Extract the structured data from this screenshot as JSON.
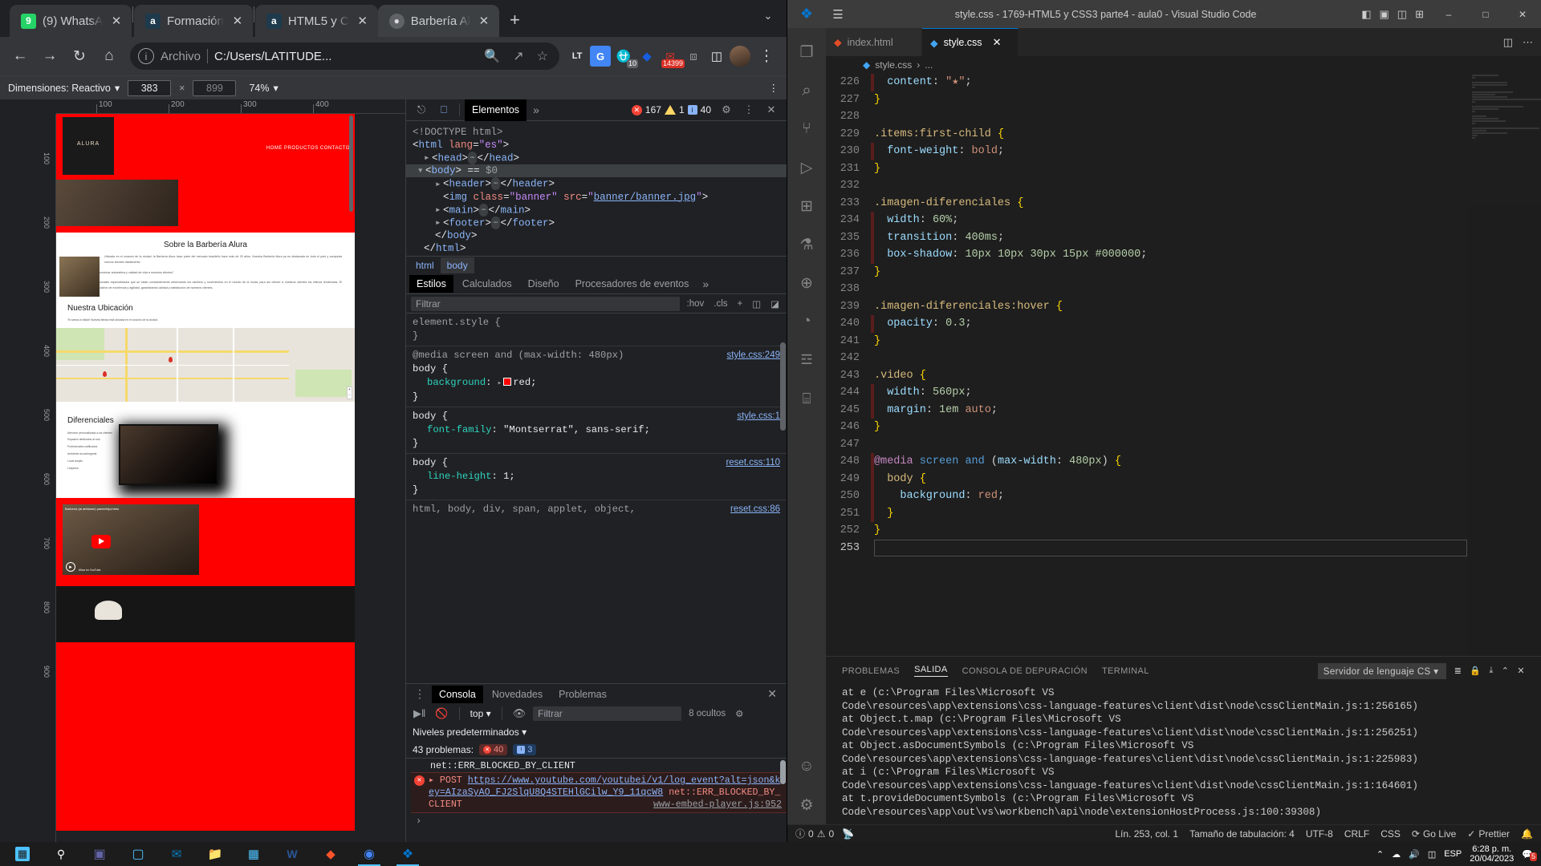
{
  "browser": {
    "tabs": [
      {
        "title": "(9) WhatsA",
        "favicon_name": "whatsapp-icon",
        "favicon_char": "9",
        "favicon_bg": "#25d366",
        "active": false
      },
      {
        "title": "Formación",
        "favicon_name": "alura-icon",
        "favicon_char": "a",
        "favicon_bg": "#1e3a4c",
        "active": false
      },
      {
        "title": "HTML5 y C",
        "favicon_name": "alura-icon",
        "favicon_char": "a",
        "favicon_bg": "#1e3a4c",
        "active": false
      },
      {
        "title": "Barbería Al",
        "favicon_name": "globe-icon",
        "favicon_char": "●",
        "favicon_bg": "#5f6368",
        "active": true
      }
    ],
    "new_tab_label": "+",
    "window_controls": {
      "minimize": "–",
      "maximize": "□",
      "close": "✕",
      "collapse": "⌄"
    },
    "toolbar": {
      "back": "←",
      "forward": "→",
      "reload": "↻",
      "home": "⌂",
      "scheme_label": "Archivo",
      "url": "C:/Users/LATITUDE...",
      "zoom_action": "search-zoom",
      "share_action": "share",
      "bookmark_action": "star"
    },
    "extensions": [
      {
        "name": "languagetool-icon",
        "glyph": "LT",
        "badge": ""
      },
      {
        "name": "google-translate-icon",
        "glyph": "G",
        "badge": ""
      },
      {
        "name": "adblock-icon",
        "glyph": "⛨",
        "badge": "10"
      },
      {
        "name": "bitwarden-icon",
        "glyph": "◈",
        "badge": ""
      },
      {
        "name": "mail-icon",
        "glyph": "✉",
        "badge": "14399"
      },
      {
        "name": "puzzle-extensions-icon",
        "glyph": "⧉",
        "badge": ""
      },
      {
        "name": "sidepanel-icon",
        "glyph": "◫",
        "badge": ""
      }
    ],
    "profile_name": "profile-avatar",
    "menu_label": "⋮"
  },
  "device_toolbar": {
    "dimensions_label": "Dimensiones: Reactivo",
    "dropdown_caret": "▾",
    "width_value": "383",
    "times": "×",
    "height_value": "899",
    "zoom_value": "74%",
    "more_label": "⋮"
  },
  "viewport": {
    "ruler_marks": [
      "100",
      "200",
      "300",
      "400"
    ],
    "ruler_v_marks": [
      "100",
      "200",
      "300",
      "400",
      "500",
      "600",
      "700",
      "800",
      "900"
    ],
    "page": {
      "logo_text": "ALURA",
      "nav_items": "HOME  PRODUCTOS  CONTACTO",
      "section_about_title": "Sobre la Barbería Alura",
      "about_paragraph_1": "Ubicada en el corazón de la ciudad, la Barbería Alura hace parte del mercado brasileño hace más de 20 años. Nuestra Barbería Alura ya es destacada en todo el país y conquista nuevos clientes diariamente.",
      "about_paragraph_2": "Nuestra misión es \"Proporcionar autoestima y calidad de vida a nuestros clientes\".",
      "about_paragraph_3": "Ofrecemos a los profesionales especializados que se están constantemente observando los cambios y movimientos en el mundo de la moda, para así ofrecer a nuestros clientes los últimos tendencias. El atendimiento posee un padrón de excelencia y agilidad, garantizando calidad y satisfacción de nuestros clientes.",
      "section_location_title": "Nuestra Ubicación",
      "location_text": "Te vamos a visitar! Nuestra tienda está ubicada en el corazón de la ciudad.",
      "section_diff_title": "Diferenciales",
      "diff_items": [
        "Atención personalizada a los clientes",
        "Espacios dedicados al ocio",
        "Profesionales calificados",
        "Ambiente aconchegante",
        "Local amplio",
        "Limpieza"
      ]
    }
  },
  "devtools": {
    "inspect_icon": "inspect-element-icon",
    "device_icon": "toggle-device-icon",
    "tabs": [
      {
        "label": "Elementos",
        "selected": true
      }
    ],
    "more_tabs": "»",
    "counters": {
      "errors": "167",
      "warnings": "1",
      "info": "40"
    },
    "settings_icon": "gear-icon",
    "kebab_icon": "more-vertical-icon",
    "close_icon": "close-icon",
    "dom": {
      "lines": [
        {
          "html": "&lt;!DOCTYPE html&gt;",
          "cls": "strc"
        },
        {
          "html": "&lt;<span class=\"tagc\">html</span> <span class=\"attrc\">lang</span>=<span class=\"valc\">\"es\"</span>&gt;",
          "cls": ""
        },
        {
          "html": "<span class=\"arrow\">▸</span>&lt;<span class=\"tagc\">head</span>&gt;<span class=\"ellip\">⋯</span>&lt;/<span class=\"tagc\">head</span>&gt;",
          "cls": "",
          "indent": 1
        },
        {
          "html": "<span class=\"arrow\">▾</span>&lt;<span class=\"tagc\">body</span>&gt; == <span class=\"strc\">$0</span>",
          "cls": "sel",
          "indent": 1
        },
        {
          "html": "<span class=\"arrow\">▸</span>&lt;<span class=\"tagc\">header</span>&gt;<span class=\"ellip\">⋯</span>&lt;/<span class=\"tagc\">header</span>&gt;",
          "cls": "",
          "indent": 2
        },
        {
          "html": "&lt;<span class=\"tagc\">img</span> <span class=\"attrc\">class</span>=<span class=\"valc\">\"banner\"</span> <span class=\"attrc\">src</span>=<span class=\"valc\">\"</span><span class=\"linkc\">banner/banner.jpg</span><span class=\"valc\">\"</span>&gt;",
          "cls": "",
          "indent": 2
        },
        {
          "html": "<span class=\"arrow\">▸</span>&lt;<span class=\"tagc\">main</span>&gt;<span class=\"ellip\">⋯</span>&lt;/<span class=\"tagc\">main</span>&gt;",
          "cls": "",
          "indent": 2
        },
        {
          "html": "<span class=\"arrow\">▸</span>&lt;<span class=\"tagc\">footer</span>&gt;<span class=\"ellip\">⋯</span>&lt;/<span class=\"tagc\">footer</span>&gt;",
          "cls": "",
          "indent": 2
        },
        {
          "html": "&lt;/<span class=\"tagc\">body</span>&gt;",
          "cls": "",
          "indent": 1
        },
        {
          "html": "&lt;/<span class=\"tagc\">html</span>&gt;",
          "cls": "",
          "indent": 0
        }
      ]
    },
    "breadcrumbs": [
      {
        "label": "html",
        "selected": false
      },
      {
        "label": "body",
        "selected": true
      }
    ],
    "style_tabs": [
      {
        "label": "Estilos",
        "selected": true
      },
      {
        "label": "Calculados",
        "selected": false
      },
      {
        "label": "Diseño",
        "selected": false
      },
      {
        "label": "Procesadores de eventos",
        "selected": false
      }
    ],
    "style_more": "»",
    "filter_placeholder": "Filtrar",
    "filter_buttons": [
      ":hov",
      ".cls",
      "+"
    ],
    "style_rules": [
      {
        "selector": "element.style",
        "media": "",
        "source": "",
        "props": []
      },
      {
        "selector": "body",
        "media": "@media screen and (max-width: 480px)",
        "source": "style.css:249",
        "props": [
          {
            "name": "background",
            "value": "red",
            "swatch": "#ff0000",
            "expandable": true
          }
        ]
      },
      {
        "selector": "body",
        "media": "",
        "source": "style.css:1",
        "props": [
          {
            "name": "font-family",
            "value": "\"Montserrat\", sans-serif",
            "swatch": "",
            "expandable": false
          }
        ]
      },
      {
        "selector": "body",
        "media": "",
        "source": "reset.css:110",
        "props": [
          {
            "name": "line-height",
            "value": "1",
            "swatch": "",
            "expandable": false
          }
        ]
      },
      {
        "selector": "html, body, div, span, applet, object,",
        "media": "",
        "source": "reset.css:86",
        "props": []
      }
    ]
  },
  "console": {
    "tabs": [
      {
        "label": "Consola",
        "selected": true
      },
      {
        "label": "Novedades",
        "selected": false
      },
      {
        "label": "Problemas",
        "selected": false
      }
    ],
    "kebab": "⋮",
    "close": "✕",
    "toolbar": {
      "execute_icon": "execute-context-icon",
      "clear_icon": "clear-console-icon",
      "context_label": "top",
      "context_caret": "▾",
      "eye_icon": "live-expression-icon",
      "filter_placeholder": "Filtrar",
      "hidden_count": "8 ocultos",
      "settings_icon": "gear-icon"
    },
    "levels_label": "Niveles predeterminados",
    "levels_caret": "▾",
    "problems_label": "43 problemas:",
    "error_count": "40",
    "info_count": "3",
    "messages": [
      {
        "type": "plain",
        "text": "net::ERR_BLOCKED_BY_CLIENT"
      },
      {
        "type": "error",
        "prefix": "▸ POST ",
        "link": "https://www.youtube.com/youtubei/v1/log_event?alt=json&key=AIzaSyAO_FJ2SlqU8Q4STEHlGCilw_Y9_11qcW8",
        "source": "www-embed-player.js:952",
        "suffix": " net::ERR_BLOCKED_BY_CLIENT"
      }
    ],
    "prompt_caret": "›"
  },
  "vscode": {
    "title": "style.css - 1769-HTML5 y CSS3 parte4 - aula0 - Visual Studio Code",
    "hamburger": "☰",
    "layout_icons": [
      "◧",
      "▣",
      "◫",
      "⊞"
    ],
    "window_controls": {
      "minimize": "–",
      "maximize": "□",
      "close": "✕"
    },
    "activity_items": [
      {
        "name": "explorer-icon",
        "glyph": "❐",
        "active": false
      },
      {
        "name": "search-icon",
        "glyph": "⌕",
        "active": false
      },
      {
        "name": "source-control-icon",
        "glyph": "⑂",
        "active": false
      },
      {
        "name": "run-debug-icon",
        "glyph": "▷",
        "active": false
      },
      {
        "name": "extensions-icon",
        "glyph": "⊞",
        "active": false
      },
      {
        "name": "testing-icon",
        "glyph": "⚗",
        "active": false
      },
      {
        "name": "live-share-icon",
        "glyph": "⊕",
        "active": false
      },
      {
        "name": "edge-tools-icon",
        "glyph": "◔",
        "active": false
      },
      {
        "name": "docker-icon",
        "glyph": "☲",
        "active": false
      },
      {
        "name": "remote-explorer-icon",
        "glyph": "⌸",
        "active": false
      },
      {
        "name": "accounts-icon",
        "glyph": "☺",
        "active": false
      },
      {
        "name": "settings-gear-icon",
        "glyph": "⚙",
        "active": false
      }
    ],
    "editor_tabs": [
      {
        "label": "index.html",
        "icon_name": "html-file-icon",
        "icon_char": "◆",
        "icon_color": "#e44d26",
        "active": false
      },
      {
        "label": "style.css",
        "icon_name": "css-file-icon",
        "icon_char": "◆",
        "icon_color": "#42a5f5",
        "active": true,
        "close": "✕"
      }
    ],
    "tab_actions": [
      "◫",
      "⋯"
    ],
    "breadcrumb": {
      "icon_name": "css-file-icon",
      "file": "style.css",
      "sep": "›",
      "symbol": "..."
    },
    "code": {
      "first_line": 226,
      "lines": [
        {
          "n": 226,
          "html": "  <span class=\"k-prop\">content</span><span class=\"k-punc\">:</span> <span class=\"k-str\">\"★\"</span><span class=\"k-punc\">;</span>",
          "changed": true
        },
        {
          "n": 227,
          "html": "<span class=\"k-brace\">}</span>",
          "changed": false
        },
        {
          "n": 228,
          "html": "",
          "changed": false
        },
        {
          "n": 229,
          "html": "<span class=\"k-sel\">.items:first-child</span> <span class=\"k-brace\">{</span>",
          "changed": false
        },
        {
          "n": 230,
          "html": "  <span class=\"k-prop\">font-weight</span><span class=\"k-punc\">:</span> <span class=\"k-val\">bold</span><span class=\"k-punc\">;</span>",
          "changed": true
        },
        {
          "n": 231,
          "html": "<span class=\"k-brace\">}</span>",
          "changed": false
        },
        {
          "n": 232,
          "html": "",
          "changed": false
        },
        {
          "n": 233,
          "html": "<span class=\"k-sel\">.imagen-diferenciales</span> <span class=\"k-brace\">{</span>",
          "changed": false
        },
        {
          "n": 234,
          "html": "  <span class=\"k-prop\">width</span><span class=\"k-punc\">:</span> <span class=\"k-num\">60%</span><span class=\"k-punc\">;</span>",
          "changed": true
        },
        {
          "n": 235,
          "html": "  <span class=\"k-prop\">transition</span><span class=\"k-punc\">:</span> <span class=\"k-num\">400ms</span><span class=\"k-punc\">;</span>",
          "changed": true
        },
        {
          "n": 236,
          "html": "  <span class=\"k-prop\">box-shadow</span><span class=\"k-punc\">:</span> <span class=\"k-num\">10px 10px 30px 15px</span> <span class=\"k-num\">#000000</span><span class=\"k-punc\">;</span>",
          "changed": true
        },
        {
          "n": 237,
          "html": "<span class=\"k-brace\">}</span>",
          "changed": false
        },
        {
          "n": 238,
          "html": "",
          "changed": false
        },
        {
          "n": 239,
          "html": "<span class=\"k-sel\">.imagen-diferenciales:hover</span> <span class=\"k-brace\">{</span>",
          "changed": false
        },
        {
          "n": 240,
          "html": "  <span class=\"k-prop\">opacity</span><span class=\"k-punc\">:</span> <span class=\"k-num\">0.3</span><span class=\"k-punc\">;</span>",
          "changed": true
        },
        {
          "n": 241,
          "html": "<span class=\"k-brace\">}</span>",
          "changed": false
        },
        {
          "n": 242,
          "html": "",
          "changed": false
        },
        {
          "n": 243,
          "html": "<span class=\"k-sel\">.video</span> <span class=\"k-brace\">{</span>",
          "changed": false
        },
        {
          "n": 244,
          "html": "  <span class=\"k-prop\">width</span><span class=\"k-punc\">:</span> <span class=\"k-num\">560px</span><span class=\"k-punc\">;</span>",
          "changed": true
        },
        {
          "n": 245,
          "html": "  <span class=\"k-prop\">margin</span><span class=\"k-punc\">:</span> <span class=\"k-num\">1em</span> <span class=\"k-val\">auto</span><span class=\"k-punc\">;</span>",
          "changed": true
        },
        {
          "n": 246,
          "html": "<span class=\"k-brace\">}</span>",
          "changed": false
        },
        {
          "n": 247,
          "html": "",
          "changed": false
        },
        {
          "n": 248,
          "html": "<span class=\"k-at\">@media</span> <span class=\"k-kw\">screen</span> <span class=\"k-kw\">and</span> <span class=\"k-punc\">(</span><span class=\"k-prop\">max-width</span><span class=\"k-punc\">:</span> <span class=\"k-num\">480px</span><span class=\"k-punc\">)</span> <span class=\"k-brace\">{</span>",
          "changed": true
        },
        {
          "n": 249,
          "html": "  <span class=\"k-sel\">body</span> <span class=\"k-brace\">{</span>",
          "changed": true
        },
        {
          "n": 250,
          "html": "    <span class=\"k-prop\">background</span><span class=\"k-punc\">:</span> <span class=\"k-val\">red</span><span class=\"k-punc\">;</span>",
          "changed": true
        },
        {
          "n": 251,
          "html": "  <span class=\"k-brace\">}</span>",
          "changed": true
        },
        {
          "n": 252,
          "html": "<span class=\"k-brace\">}</span>",
          "changed": false
        },
        {
          "n": 253,
          "html": "",
          "changed": false,
          "caret": true
        }
      ]
    },
    "panel": {
      "tabs": [
        {
          "label": "PROBLEMAS",
          "selected": false
        },
        {
          "label": "SALIDA",
          "selected": true
        },
        {
          "label": "CONSOLA DE DEPURACIÓN",
          "selected": false
        },
        {
          "label": "TERMINAL",
          "selected": false
        }
      ],
      "select_value": "Servidor de lenguaje CS",
      "select_caret": "▾",
      "actions": [
        "≣",
        "🔒",
        "⤓",
        "⌃",
        "✕"
      ],
      "output_lines": [
        "at e (c:\\Program Files\\Microsoft VS",
        "Code\\resources\\app\\extensions\\css-language-features\\client\\dist\\node\\cssClientMain.js:1:256165)",
        "    at Object.t.map (c:\\Program Files\\Microsoft VS",
        "Code\\resources\\app\\extensions\\css-language-features\\client\\dist\\node\\cssClientMain.js:1:256251)",
        "    at Object.asDocumentSymbols (c:\\Program Files\\Microsoft VS",
        "Code\\resources\\app\\extensions\\css-language-features\\client\\dist\\node\\cssClientMain.js:1:225983)",
        "    at i (c:\\Program Files\\Microsoft VS",
        "Code\\resources\\app\\extensions\\css-language-features\\client\\dist\\node\\cssClientMain.js:1:164601)",
        "    at t.provideDocumentSymbols (c:\\Program Files\\Microsoft VS",
        "Code\\resources\\app\\out\\vs\\workbench\\api\\node\\extensionHostProcess.js:100:39308)"
      ]
    },
    "status": {
      "errors_icon": "error-icon",
      "errors": "0",
      "warnings_icon": "warning-icon",
      "warnings": "0",
      "radio_icon": "broadcast-icon",
      "cursor": "Lín. 253, col. 1",
      "indent": "Tamaño de tabulación: 4",
      "encoding": "UTF-8",
      "eol": "CRLF",
      "language": "CSS",
      "golive": "Go Live",
      "golive_icon": "⟳",
      "prettier": "Prettier",
      "prettier_icon": "✓",
      "bell_icon": "bell-icon",
      "remote_icon": "remote-icon",
      "feedback_icon": "smiley-icon"
    }
  },
  "taskbar": {
    "items": [
      {
        "name": "start-button",
        "glyph": "⊞",
        "color": "#4cc2ff",
        "active": false
      },
      {
        "name": "search-taskbar-icon",
        "glyph": "⌕",
        "color": "#ffffff",
        "active": false
      },
      {
        "name": "teams-icon",
        "glyph": "◰",
        "color": "#6264a7",
        "active": false
      },
      {
        "name": "store-icon",
        "glyph": "◱",
        "color": "#4cc2ff",
        "active": false
      },
      {
        "name": "outlook-icon",
        "glyph": "✉",
        "color": "#0a7bbd",
        "active": false
      },
      {
        "name": "file-explorer-icon",
        "glyph": "🗀",
        "color": "#ffc83d",
        "active": false
      },
      {
        "name": "windows-apps-icon",
        "glyph": "⊞",
        "color": "#4cc2ff",
        "active": false
      },
      {
        "name": "word-icon",
        "glyph": "W",
        "color": "#2b5797",
        "active": false
      },
      {
        "name": "brave-icon",
        "glyph": "◆",
        "color": "#fb542b",
        "active": false
      },
      {
        "name": "chrome-icon",
        "glyph": "◉",
        "color": "#4285f4",
        "active": true
      },
      {
        "name": "vscode-icon",
        "glyph": "◈",
        "color": "#0078d4",
        "active": true
      }
    ],
    "tray": {
      "chevron": "⌃",
      "onedrive_icon": "☁",
      "volume_icon": "🔊",
      "network_icon": "◫",
      "language": "ESP",
      "time": "6:28 p. m.",
      "date": "20/04/2023",
      "notification_icon": "💬",
      "notification_count": "5"
    }
  }
}
